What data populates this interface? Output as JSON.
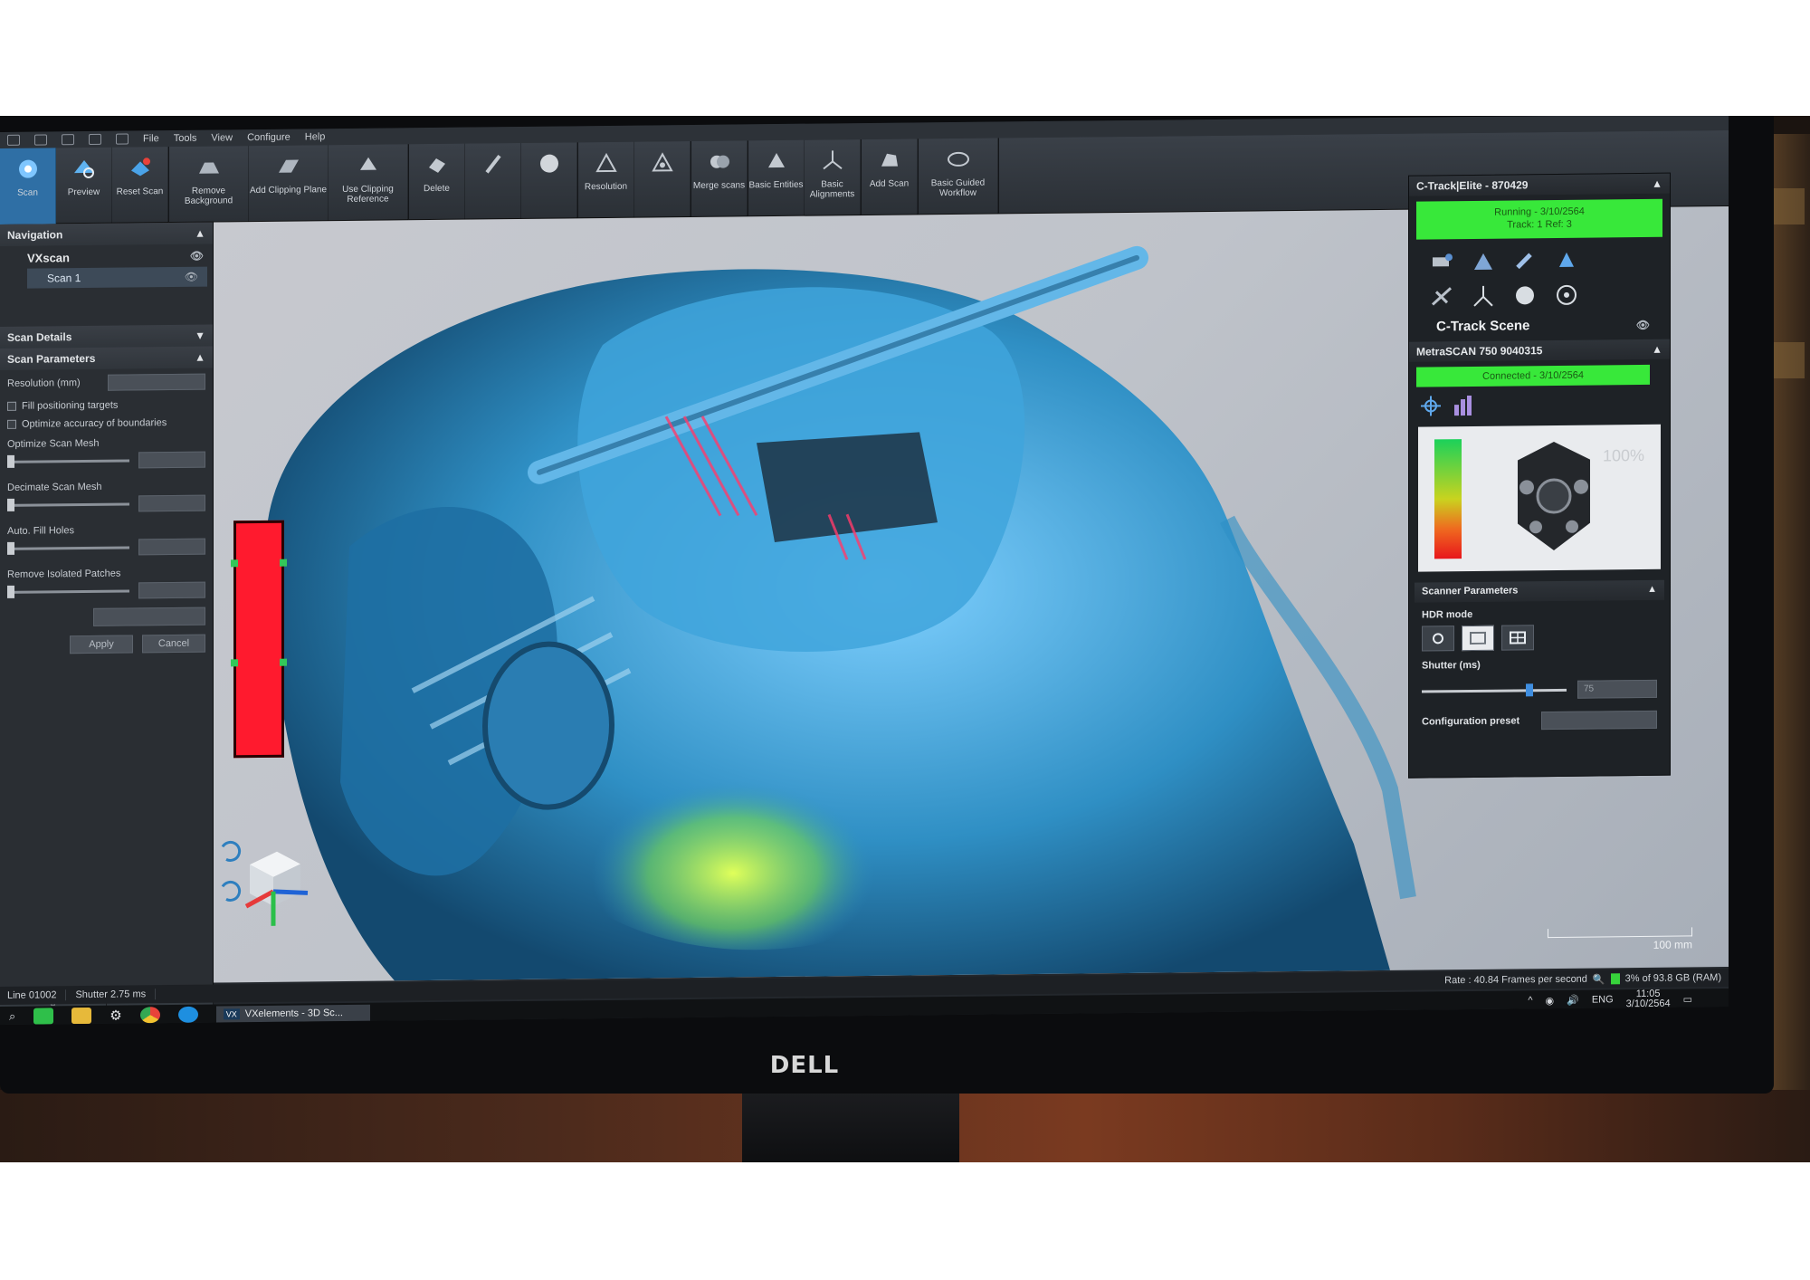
{
  "menu": [
    "File",
    "Tools",
    "View",
    "Configure",
    "Help"
  ],
  "ribbon": {
    "scan": "Scan",
    "preview": "Preview",
    "reset_scan": "Reset Scan",
    "remove_background": "Remove Background",
    "add_clipping_plane": "Add Clipping Plane",
    "use_clipping_reference": "Use Clipping Reference",
    "delete_group": "Delete",
    "resolution_group": "Resolution",
    "merge_scans": "Merge scans",
    "basic_entities": "Basic Entities",
    "basic_alignments": "Basic Alignments",
    "add_scan": "Add Scan",
    "basic_guided_workflow": "Basic Guided Workflow"
  },
  "navigation": {
    "title": "Navigation",
    "root": "VXscan",
    "child": "Scan 1"
  },
  "scan_details": {
    "title": "Scan Details",
    "params_title": "Scan Parameters",
    "resolution_label": "Resolution (mm)",
    "fill_targets": "Fill positioning targets",
    "optimize_boundaries": "Optimize accuracy of boundaries",
    "optimize_mesh": "Optimize Scan Mesh",
    "decimate_mesh": "Decimate Scan Mesh",
    "auto_fill_holes": "Auto. Fill Holes",
    "remove_patches": "Remove Isolated Patches",
    "apply": "Apply",
    "cancel": "Cancel"
  },
  "viewport": {
    "scale_label": "100 mm"
  },
  "ctrack": {
    "title": "C-Track|Elite - 870429",
    "status_line1": "Running - 3/10/2564",
    "status_line2": "Track: 1 Ref: 3",
    "scene_label": "C-Track Scene"
  },
  "metrascan": {
    "title": "MetraSCAN 750 9040315",
    "status": "Connected - 3/10/2564",
    "percent": "100%"
  },
  "scanner_params": {
    "title": "Scanner Parameters",
    "hdr_mode": "HDR mode",
    "shutter": "Shutter (ms)",
    "shutter_value": "75",
    "config_preset": "Configuration preset"
  },
  "statusbar": {
    "left1": "Line 01002",
    "left2": "Shutter 2.75 ms",
    "rate": "Rate : 40.84 Frames per second",
    "ram": "3% of 93.8 GB (RAM)"
  },
  "taskbar": {
    "app_label": "VXelements - 3D Sc...",
    "lang": "ENG",
    "time": "11:05",
    "date": "3/10/2564"
  },
  "monitor_brand": "DELL",
  "colors": {
    "scan_surface": "#2f8fc4",
    "status_green": "#38e83a",
    "meter_red": "#ff1a2e",
    "ribbon_active": "#2f6fa5"
  }
}
